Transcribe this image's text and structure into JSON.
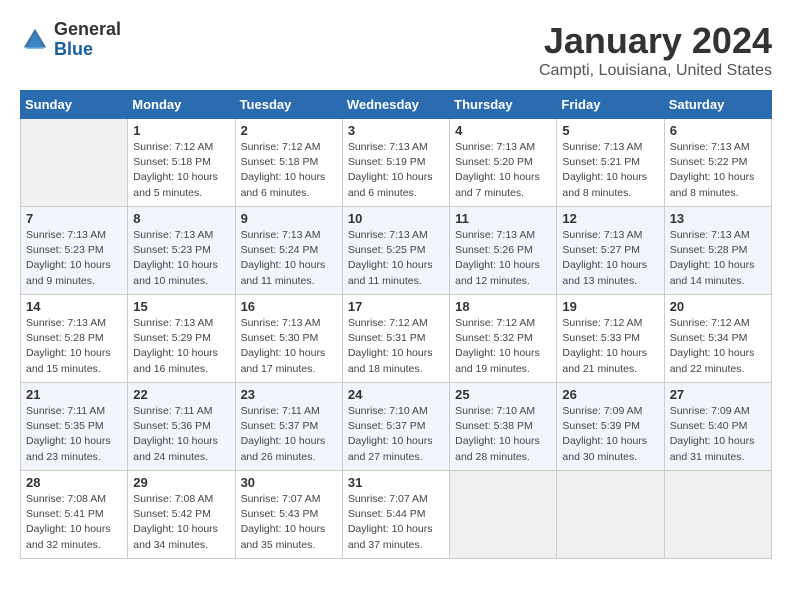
{
  "header": {
    "logo_general": "General",
    "logo_blue": "Blue",
    "month_title": "January 2024",
    "location": "Campti, Louisiana, United States"
  },
  "weekdays": [
    "Sunday",
    "Monday",
    "Tuesday",
    "Wednesday",
    "Thursday",
    "Friday",
    "Saturday"
  ],
  "weeks": [
    [
      {
        "num": "",
        "info": ""
      },
      {
        "num": "1",
        "info": "Sunrise: 7:12 AM\nSunset: 5:18 PM\nDaylight: 10 hours\nand 5 minutes."
      },
      {
        "num": "2",
        "info": "Sunrise: 7:12 AM\nSunset: 5:18 PM\nDaylight: 10 hours\nand 6 minutes."
      },
      {
        "num": "3",
        "info": "Sunrise: 7:13 AM\nSunset: 5:19 PM\nDaylight: 10 hours\nand 6 minutes."
      },
      {
        "num": "4",
        "info": "Sunrise: 7:13 AM\nSunset: 5:20 PM\nDaylight: 10 hours\nand 7 minutes."
      },
      {
        "num": "5",
        "info": "Sunrise: 7:13 AM\nSunset: 5:21 PM\nDaylight: 10 hours\nand 8 minutes."
      },
      {
        "num": "6",
        "info": "Sunrise: 7:13 AM\nSunset: 5:22 PM\nDaylight: 10 hours\nand 8 minutes."
      }
    ],
    [
      {
        "num": "7",
        "info": "Sunrise: 7:13 AM\nSunset: 5:23 PM\nDaylight: 10 hours\nand 9 minutes."
      },
      {
        "num": "8",
        "info": "Sunrise: 7:13 AM\nSunset: 5:23 PM\nDaylight: 10 hours\nand 10 minutes."
      },
      {
        "num": "9",
        "info": "Sunrise: 7:13 AM\nSunset: 5:24 PM\nDaylight: 10 hours\nand 11 minutes."
      },
      {
        "num": "10",
        "info": "Sunrise: 7:13 AM\nSunset: 5:25 PM\nDaylight: 10 hours\nand 11 minutes."
      },
      {
        "num": "11",
        "info": "Sunrise: 7:13 AM\nSunset: 5:26 PM\nDaylight: 10 hours\nand 12 minutes."
      },
      {
        "num": "12",
        "info": "Sunrise: 7:13 AM\nSunset: 5:27 PM\nDaylight: 10 hours\nand 13 minutes."
      },
      {
        "num": "13",
        "info": "Sunrise: 7:13 AM\nSunset: 5:28 PM\nDaylight: 10 hours\nand 14 minutes."
      }
    ],
    [
      {
        "num": "14",
        "info": "Sunrise: 7:13 AM\nSunset: 5:28 PM\nDaylight: 10 hours\nand 15 minutes."
      },
      {
        "num": "15",
        "info": "Sunrise: 7:13 AM\nSunset: 5:29 PM\nDaylight: 10 hours\nand 16 minutes."
      },
      {
        "num": "16",
        "info": "Sunrise: 7:13 AM\nSunset: 5:30 PM\nDaylight: 10 hours\nand 17 minutes."
      },
      {
        "num": "17",
        "info": "Sunrise: 7:12 AM\nSunset: 5:31 PM\nDaylight: 10 hours\nand 18 minutes."
      },
      {
        "num": "18",
        "info": "Sunrise: 7:12 AM\nSunset: 5:32 PM\nDaylight: 10 hours\nand 19 minutes."
      },
      {
        "num": "19",
        "info": "Sunrise: 7:12 AM\nSunset: 5:33 PM\nDaylight: 10 hours\nand 21 minutes."
      },
      {
        "num": "20",
        "info": "Sunrise: 7:12 AM\nSunset: 5:34 PM\nDaylight: 10 hours\nand 22 minutes."
      }
    ],
    [
      {
        "num": "21",
        "info": "Sunrise: 7:11 AM\nSunset: 5:35 PM\nDaylight: 10 hours\nand 23 minutes."
      },
      {
        "num": "22",
        "info": "Sunrise: 7:11 AM\nSunset: 5:36 PM\nDaylight: 10 hours\nand 24 minutes."
      },
      {
        "num": "23",
        "info": "Sunrise: 7:11 AM\nSunset: 5:37 PM\nDaylight: 10 hours\nand 26 minutes."
      },
      {
        "num": "24",
        "info": "Sunrise: 7:10 AM\nSunset: 5:37 PM\nDaylight: 10 hours\nand 27 minutes."
      },
      {
        "num": "25",
        "info": "Sunrise: 7:10 AM\nSunset: 5:38 PM\nDaylight: 10 hours\nand 28 minutes."
      },
      {
        "num": "26",
        "info": "Sunrise: 7:09 AM\nSunset: 5:39 PM\nDaylight: 10 hours\nand 30 minutes."
      },
      {
        "num": "27",
        "info": "Sunrise: 7:09 AM\nSunset: 5:40 PM\nDaylight: 10 hours\nand 31 minutes."
      }
    ],
    [
      {
        "num": "28",
        "info": "Sunrise: 7:08 AM\nSunset: 5:41 PM\nDaylight: 10 hours\nand 32 minutes."
      },
      {
        "num": "29",
        "info": "Sunrise: 7:08 AM\nSunset: 5:42 PM\nDaylight: 10 hours\nand 34 minutes."
      },
      {
        "num": "30",
        "info": "Sunrise: 7:07 AM\nSunset: 5:43 PM\nDaylight: 10 hours\nand 35 minutes."
      },
      {
        "num": "31",
        "info": "Sunrise: 7:07 AM\nSunset: 5:44 PM\nDaylight: 10 hours\nand 37 minutes."
      },
      {
        "num": "",
        "info": ""
      },
      {
        "num": "",
        "info": ""
      },
      {
        "num": "",
        "info": ""
      }
    ]
  ]
}
